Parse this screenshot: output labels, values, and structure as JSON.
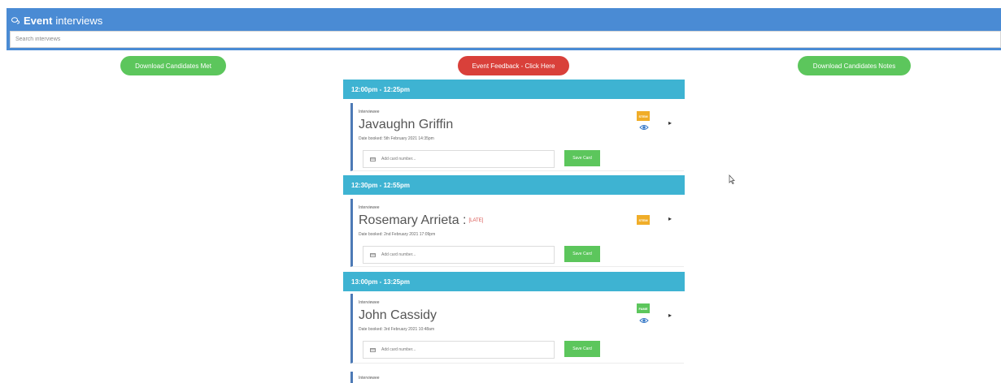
{
  "header": {
    "title_bold": "Event",
    "title_rest": "interviews",
    "title_icon": "chat-bubbles-icon"
  },
  "search": {
    "placeholder": "Search interviews"
  },
  "actions": {
    "download_met": "Download Candidates Met",
    "event_feedback": "Event Feedback - Click Here",
    "download_notes": "Download Candidates Notes"
  },
  "colors": {
    "header": "#4a8bd4",
    "slot": "#3eb3d2",
    "green": "#5cc65c",
    "red": "#d9403a",
    "orange": "#f0ad28",
    "card_border": "#4d7ab6"
  },
  "slots": [
    {
      "time": "12:00pm - 12:25pm",
      "role": "Interviewee",
      "name": "Javaughn Griffin",
      "late": "",
      "booked": "Date booked: 5th February 2021 14:35pm",
      "card_placeholder": "Add card number...",
      "save_label": "Save Card",
      "badge": "STEM",
      "badge_color": "orange",
      "has_eye": true
    },
    {
      "time": "12:30pm - 12:55pm",
      "role": "Interviewee",
      "name": "Rosemary Arrieta :",
      "late": "[LATE]",
      "booked": "Date booked: 2nd February 2021 17:09pm",
      "card_placeholder": "Add card number...",
      "save_label": "Save Card",
      "badge": "STEM",
      "badge_color": "orange",
      "has_eye": false
    },
    {
      "time": "13:00pm - 13:25pm",
      "role": "Interviewee",
      "name": "John Cassidy",
      "late": "",
      "booked": "Date booked: 3rd February 2021 10:48am",
      "card_placeholder": "Add card number...",
      "save_label": "Save Card",
      "badge": "FAME",
      "badge_color": "green",
      "has_eye": true
    }
  ],
  "partial_card": {
    "role": "Interviewee"
  }
}
